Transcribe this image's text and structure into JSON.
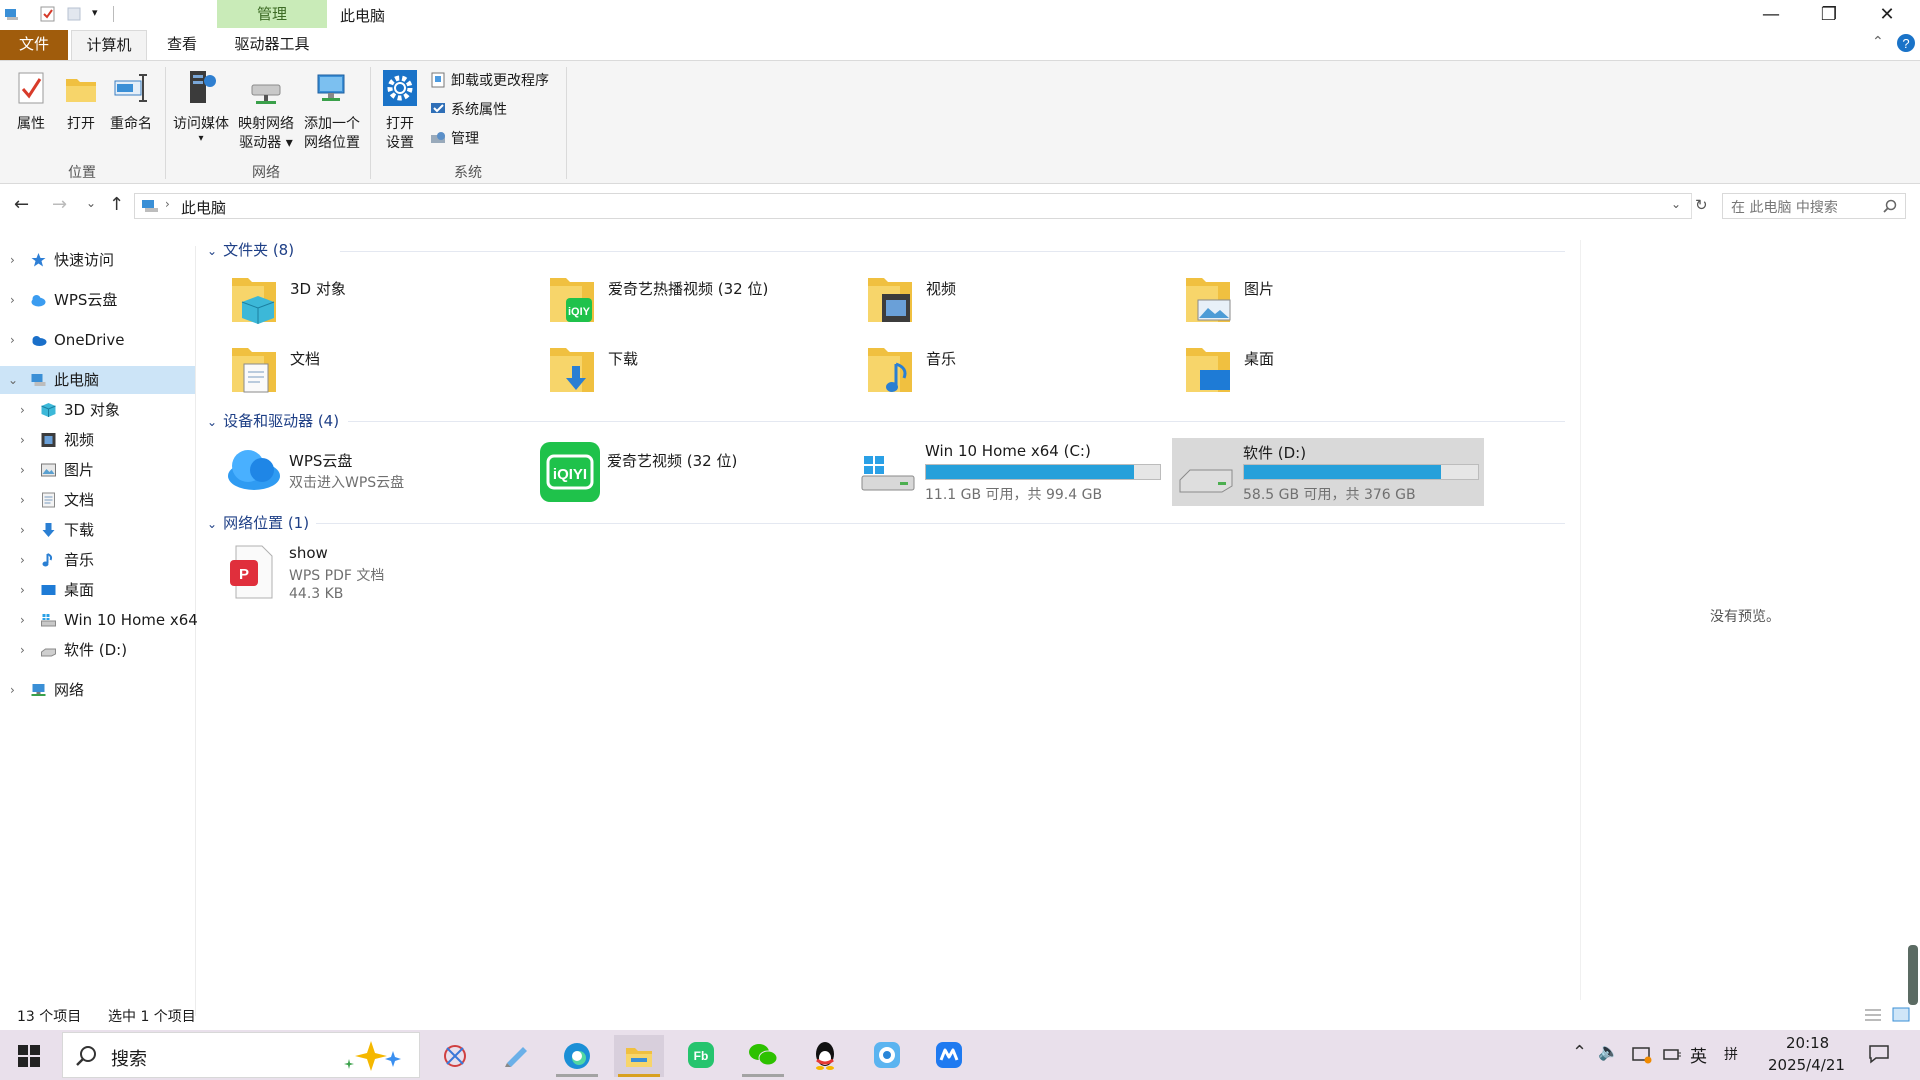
{
  "window": {
    "context_tab": "管理",
    "title": "此电脑",
    "minimize_glyph": "—",
    "maximize_glyph": "❐",
    "close_glyph": "✕"
  },
  "ribbon": {
    "tabs": [
      "文件",
      "计算机",
      "查看",
      "驱动器工具"
    ],
    "location_group": {
      "label": "位置",
      "buttons": [
        "属性",
        "打开",
        "重命名"
      ]
    },
    "network_group": {
      "label": "网络",
      "buttons": [
        {
          "line1": "访问媒体",
          "line2": ""
        },
        {
          "line1": "映射网络",
          "line2": "驱动器 ▾"
        },
        {
          "line1": "添加一个",
          "line2": "网络位置"
        }
      ]
    },
    "system_group": {
      "label": "系统",
      "open_settings": {
        "line1": "打开",
        "line2": "设置"
      },
      "items": [
        "卸载或更改程序",
        "系统属性",
        "管理"
      ]
    }
  },
  "address": {
    "path": "此电脑",
    "search_placeholder": "在 此电脑 中搜索"
  },
  "nav": {
    "items": [
      {
        "label": "快速访问",
        "icon": "star-icon"
      },
      {
        "label": "WPS云盘",
        "icon": "cloud-icon"
      },
      {
        "label": "OneDrive",
        "icon": "onedrive-icon"
      },
      {
        "label": "此电脑",
        "icon": "computer-icon"
      },
      {
        "label": "3D 对象",
        "icon": "cube-icon"
      },
      {
        "label": "视频",
        "icon": "video-icon"
      },
      {
        "label": "图片",
        "icon": "picture-icon"
      },
      {
        "label": "文档",
        "icon": "document-icon"
      },
      {
        "label": "下载",
        "icon": "download-icon"
      },
      {
        "label": "音乐",
        "icon": "music-icon"
      },
      {
        "label": "桌面",
        "icon": "desktop-icon"
      },
      {
        "label": "Win 10 Home x64",
        "icon": "drive-c-icon"
      },
      {
        "label": "软件 (D:)",
        "icon": "drive-d-icon"
      },
      {
        "label": "网络",
        "icon": "network-icon"
      }
    ]
  },
  "content": {
    "folders_header": "文件夹 (8)",
    "folders": [
      "3D 对象",
      "爱奇艺热播视频 (32 位)",
      "视频",
      "图片",
      "文档",
      "下载",
      "音乐",
      "桌面"
    ],
    "devices_header": "设备和驱动器 (4)",
    "devices": [
      {
        "name": "WPS云盘",
        "sub": "双击进入WPS云盘"
      },
      {
        "name": "爱奇艺视频 (32 位)",
        "sub": ""
      },
      {
        "name": "Win 10 Home x64 (C:)",
        "sub": "11.1 GB 可用，共 99.4 GB",
        "used_fraction": 0.888
      },
      {
        "name": "软件 (D:)",
        "sub": "58.5 GB 可用，共 376 GB",
        "used_fraction": 0.844
      }
    ],
    "network_header": "网络位置 (1)",
    "network_items": [
      {
        "name": "show",
        "type": "WPS PDF 文档",
        "size": "44.3 KB"
      }
    ],
    "preview_text": "没有预览。"
  },
  "status": {
    "count": "13 个项目",
    "selected": "选中 1 个项目"
  },
  "taskbar": {
    "search_label": "搜索",
    "time": "20:18",
    "date": "2025/4/21",
    "ime": "英",
    "ime2": "拼"
  },
  "colors": {
    "accent": "#26a0da",
    "file_tab": "#a05c0c",
    "context_tab": "#c9ebb8",
    "selection": "#cce4f7",
    "section_header": "#1e3f86"
  }
}
